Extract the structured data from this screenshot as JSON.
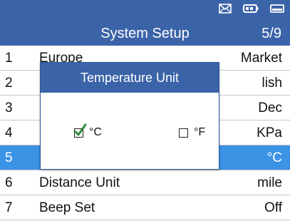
{
  "header": {
    "title": "System Setup",
    "page": "5/9"
  },
  "status_icons": [
    "mail-icon",
    "battery-icon",
    "power-icon"
  ],
  "colors": {
    "header": "#3b63a8",
    "selected_row": "#3b93e6",
    "check": "#2f8a3a"
  },
  "rows": [
    {
      "num": "1",
      "label": "Europe",
      "value": "Market"
    },
    {
      "num": "2",
      "label": "",
      "value": "lish"
    },
    {
      "num": "3",
      "label": "",
      "value": "Dec"
    },
    {
      "num": "4",
      "label": "",
      "value": "KPa"
    },
    {
      "num": "5",
      "label": "",
      "value": "°C"
    },
    {
      "num": "6",
      "label": "Distance Unit",
      "value": "mile"
    },
    {
      "num": "7",
      "label": "Beep Set",
      "value": "Off"
    }
  ],
  "dialog": {
    "title": "Temperature Unit",
    "options": [
      {
        "label": "°C",
        "checked": true
      },
      {
        "label": "°F",
        "checked": false
      }
    ]
  }
}
